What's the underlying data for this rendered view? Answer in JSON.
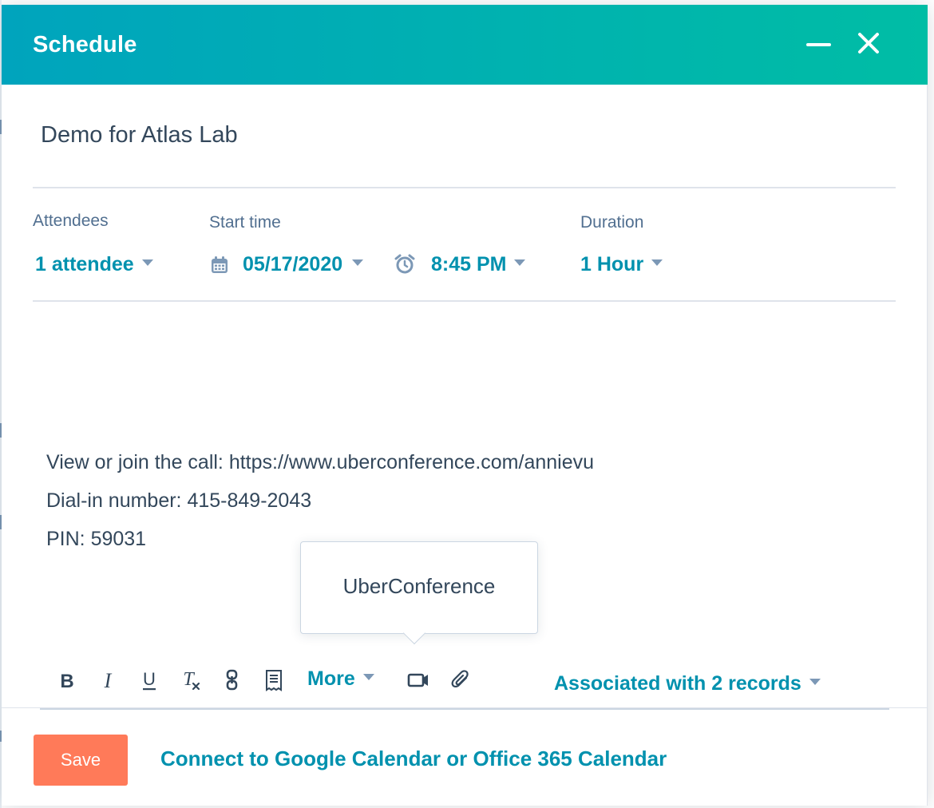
{
  "modal": {
    "title": "Schedule",
    "subject": "Demo for Atlas Lab"
  },
  "fields": {
    "attendees_label": "Attendees",
    "attendees_value": "1 attendee",
    "start_time_label": "Start time",
    "date_value": "05/17/2020",
    "time_value": "8:45 PM",
    "duration_label": "Duration",
    "duration_value": "1 Hour"
  },
  "body": {
    "lines": [
      "View or join the call: https://www.uberconference.com/annievu",
      "Dial-in number: 415-849-2043",
      "PIN: 59031"
    ]
  },
  "tooltip": {
    "text": "UberConference"
  },
  "toolbar": {
    "more_label": "More",
    "associated_label": "Associated with 2 records",
    "icons": [
      "bold-icon",
      "italic-icon",
      "underline-icon",
      "clear-format-icon",
      "link-icon",
      "snippet-icon",
      "video-icon",
      "attachment-icon"
    ]
  },
  "footer": {
    "save_label": "Save",
    "connect_label": "Connect to Google Calendar or Office 365 Calendar"
  },
  "colors": {
    "header_start": "#00a4bd",
    "header_end": "#00bda5",
    "link": "#0091ae",
    "save_button": "#ff7a59",
    "text": "#33475b"
  }
}
